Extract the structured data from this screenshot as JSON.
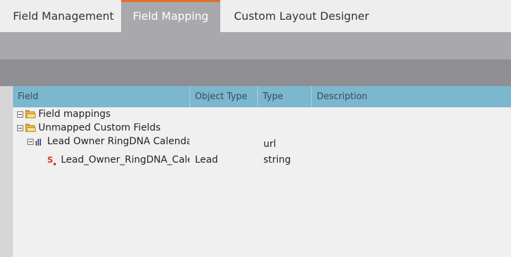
{
  "tabs": [
    {
      "label": "Field Management"
    },
    {
      "label": "Field Mapping",
      "active": true
    },
    {
      "label": "Custom Layout Designer"
    }
  ],
  "colors": {
    "active_tab_accent": "#e0702a",
    "header_bg": "#7bb7cf",
    "toolbar_light": "#a9a8ad",
    "toolbar_dark": "#8f8f93"
  },
  "grid": {
    "columns": [
      "Field",
      "Object Type",
      "Type",
      "Description"
    ],
    "rows": [
      {
        "label": "Field mappings",
        "icon": "folder-icon",
        "expanded": true,
        "object_type": "",
        "type": "",
        "description": ""
      },
      {
        "label": "Unmapped Custom Fields",
        "icon": "folder-icon",
        "expanded": true,
        "object_type": "",
        "type": "",
        "description": ""
      },
      {
        "label": "Lead Owner RingDNA Calendar",
        "icon": "field-bars-icon",
        "expanded": true,
        "object_type": "",
        "type": "url",
        "description": ""
      },
      {
        "label": "Lead_Owner_RingDNA_Calendar",
        "icon": "salesforce-field-icon",
        "object_type": "Lead",
        "type": "string",
        "description": ""
      }
    ]
  }
}
